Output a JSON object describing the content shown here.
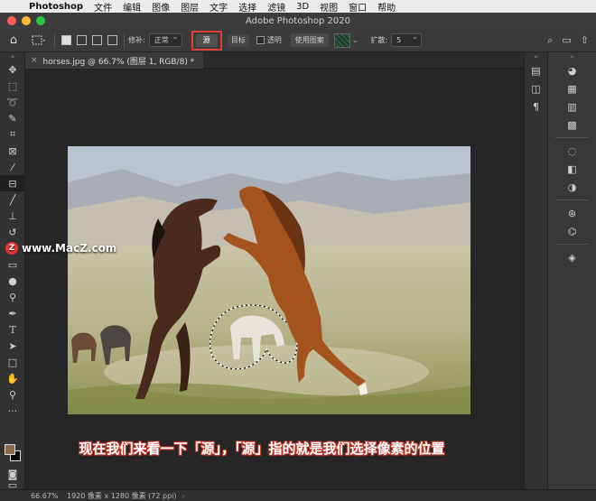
{
  "menubar": {
    "apple": "",
    "items": [
      "Photoshop",
      "文件",
      "编辑",
      "图像",
      "图层",
      "文字",
      "选择",
      "滤镜",
      "3D",
      "视图",
      "窗口",
      "帮助"
    ]
  },
  "window": {
    "title": "Adobe Photoshop 2020"
  },
  "options": {
    "repair_label": "修补:",
    "repair_mode": "正常",
    "source_label": "源",
    "target_label": "目标",
    "transparent_label": "透明",
    "use_pattern_label": "使用图案",
    "diffusion_label": "扩散:",
    "diffusion_value": "5"
  },
  "document": {
    "tab_title": "horses.jpg @ 66.7% (图层 1, RGB/8) *"
  },
  "status": {
    "zoom": "66.67%",
    "info": "1920 像素 x 1280 像素 (72 ppi)"
  },
  "overlay": {
    "watermark": "www.MacZ.com",
    "caption": "现在我们来看一下「源」，「源」指的就是我们选择像素的位置"
  },
  "colors": {
    "highlight": "#e0403a",
    "foreground_swatch": "#8a6a45",
    "background_swatch": "#000000"
  }
}
